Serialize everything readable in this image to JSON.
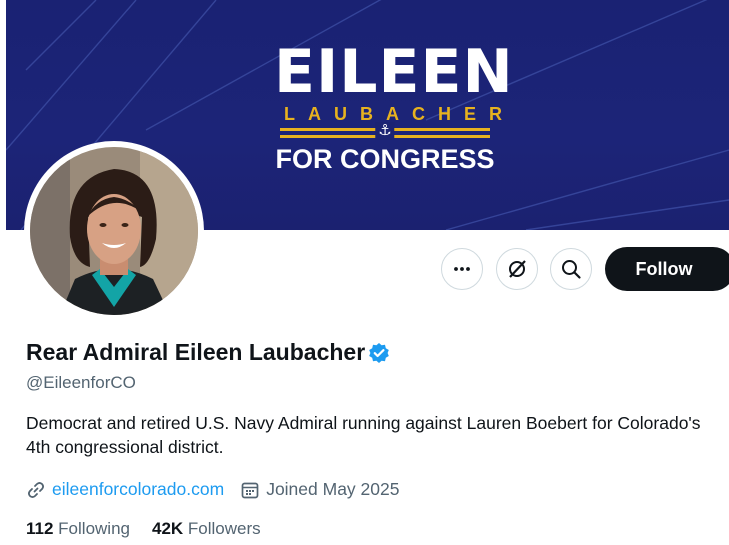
{
  "banner": {
    "logo_name": "EILEEN",
    "logo_surname": "LAUBACHER",
    "logo_tagline": "FOR CONGRESS",
    "colors": {
      "background": "#1b2373",
      "gold": "#e7b21f"
    }
  },
  "profile": {
    "display_name": "Rear Admiral Eileen Laubacher",
    "verified": true,
    "handle": "@EileenforCO",
    "bio": "Democrat and retired U.S. Navy Admiral running against Lauren Boebert for Colorado's 4th congressional district.",
    "website": "eileenforcolorado.com",
    "joined": "Joined May 2025",
    "following_count": "112",
    "following_label": "Following",
    "followers_count": "42K",
    "followers_label": "Followers"
  },
  "actions": {
    "more_icon": "more-horizontal-icon",
    "grok_icon": "grok-icon",
    "search_icon": "search-icon",
    "follow_label": "Follow"
  },
  "colors": {
    "accent": "#1d9bf0",
    "text": "#0f1419",
    "muted": "#536471",
    "button": "#0f1419"
  }
}
